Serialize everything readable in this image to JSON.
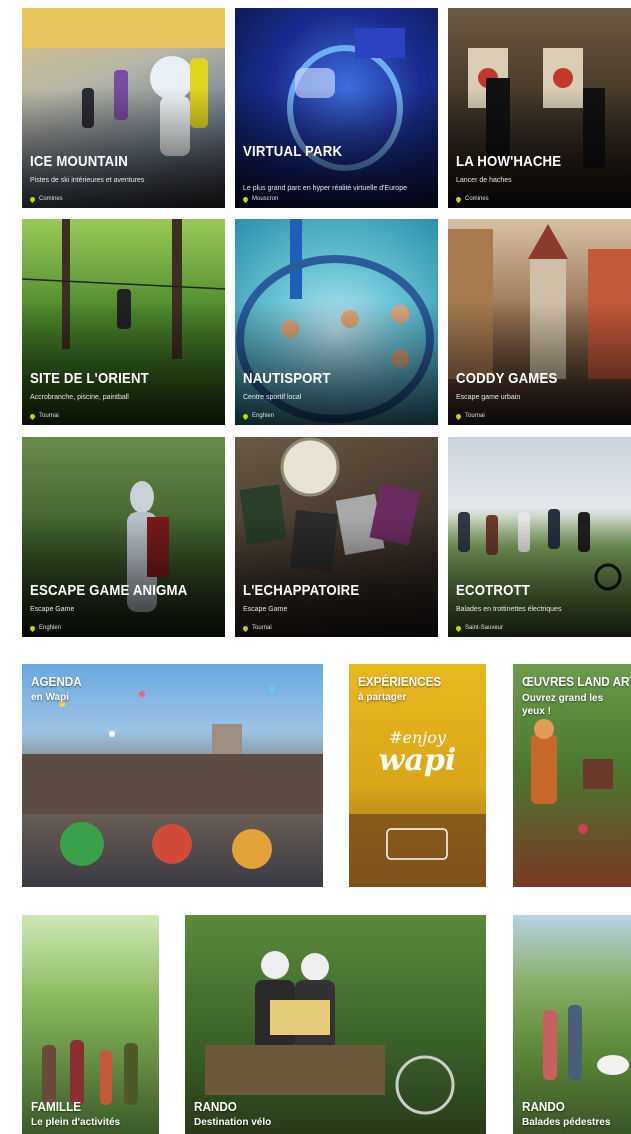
{
  "activities": [
    {
      "title": "ICE MOUNTAIN",
      "subtitle": "Pistes de ski intérieures et aventures",
      "location": "Comines"
    },
    {
      "title": "VIRTUAL PARK",
      "subtitle": "Le plus grand parc en hyper réalité virtuelle d'Europe",
      "location": "Mouscron"
    },
    {
      "title": "LA HOW'HACHE",
      "subtitle": "Lancer de haches",
      "location": "Comines"
    },
    {
      "title": "SITE DE L'ORIENT",
      "subtitle": "Accrobranche, piscine, paintball",
      "location": "Tournai"
    },
    {
      "title": "NAUTISPORT",
      "subtitle": "Centre sportif local",
      "location": "Enghien"
    },
    {
      "title": "CODDY GAMES",
      "subtitle": "Escape game urbain",
      "location": "Tournai"
    },
    {
      "title": "ESCAPE GAME ANIGMA",
      "subtitle": "Escape Game",
      "location": "Enghien"
    },
    {
      "title": "L'ECHAPPATOIRE",
      "subtitle": "Escape Game",
      "location": "Tournai"
    },
    {
      "title": "ECOTROTT",
      "subtitle": "Balades en trottinettes électriques",
      "location": "Saint-Sauveur"
    }
  ],
  "promos_row1": [
    {
      "title": "AGENDA",
      "subtitle": "en Wapi"
    },
    {
      "title": "EXPÉRIENCES",
      "subtitle": "à partager",
      "enjoy_line1": "#enjoy",
      "enjoy_line2": "wapi"
    },
    {
      "title": "ŒUVRES LAND ART",
      "subtitle": "Ouvrez grand les yeux !"
    }
  ],
  "promos_row2": [
    {
      "title": "FAMILLE",
      "subtitle": "Le plein d'activités"
    },
    {
      "title": "RANDO",
      "subtitle": "Destination vélo"
    },
    {
      "title": "RANDO",
      "subtitle": "Balades pédestres"
    }
  ],
  "colors": {
    "pin": "#c8d400",
    "experiences_bg": "#e2b21c"
  }
}
